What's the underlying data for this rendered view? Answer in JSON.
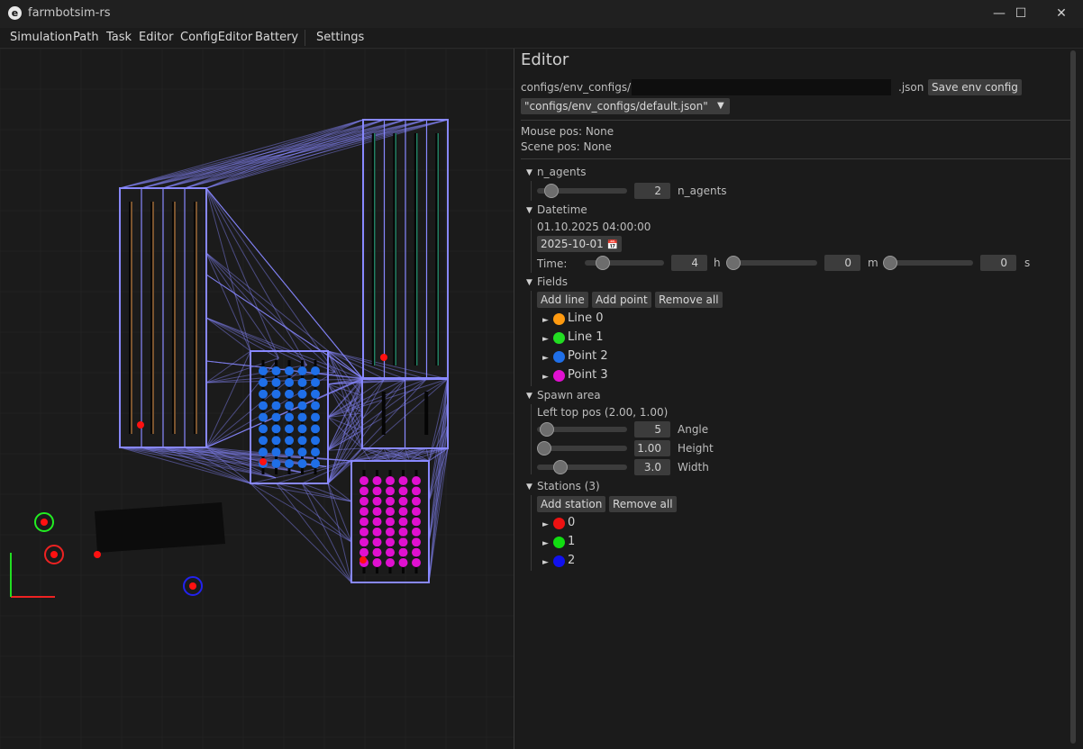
{
  "window": {
    "title": "farmbotsim-rs",
    "icon": "e",
    "controls": [
      "—",
      "☐",
      "✕"
    ]
  },
  "menu": [
    "Simulation",
    "Path",
    "Task",
    "Editor",
    "ConfigEditor",
    "Battery",
    "Settings"
  ],
  "editor": {
    "heading": "Editor",
    "config_prefix": "configs/env_configs/",
    "config_name_value": "",
    "config_suffix": ".json",
    "save_button": "Save env config",
    "dropdown_value": "\"configs/env_configs/default.json\"",
    "dropdown_arrow": "▼",
    "mouse_pos": "Mouse pos: None",
    "scene_pos": "Scene pos: None",
    "n_agents": {
      "header": "n_agents",
      "value": "2",
      "label": "n_agents",
      "slider": 0.1
    },
    "datetime": {
      "header": "Datetime",
      "text": "01.10.2025 04:00:00",
      "date_button": "2025-10-01",
      "date_icon": "📅",
      "time_label": "Time:",
      "h_value": "4",
      "h_label": "h",
      "h_slider": 0.17,
      "m_value": "0",
      "m_label": "m",
      "m_slider": 0.0,
      "s_value": "0",
      "s_label": "s",
      "s_slider": 0.0
    },
    "fields": {
      "header": "Fields",
      "add_line": "Add line",
      "add_point": "Add point",
      "remove_all": "Remove all",
      "items": [
        {
          "label": "Line 0",
          "color": "#ff9a10"
        },
        {
          "label": "Line 1",
          "color": "#22dd22"
        },
        {
          "label": "Point 2",
          "color": "#1f6fe8"
        },
        {
          "label": "Point 3",
          "color": "#e010d0"
        }
      ]
    },
    "spawn_area": {
      "header": "Spawn area",
      "left_top": "Left top pos (2.00, 1.00)",
      "angle_value": "5",
      "angle_label": "Angle",
      "angle_slider": 0.03,
      "height_value": "1.00",
      "height_label": "Height",
      "height_slider": 0.0,
      "width_value": "3.0",
      "width_label": "Width",
      "width_slider": 0.22
    },
    "stations": {
      "header": "Stations (3)",
      "add_station": "Add station",
      "remove_all": "Remove all",
      "items": [
        {
          "label": "0",
          "color": "#ee1111"
        },
        {
          "label": "1",
          "color": "#11dd11"
        },
        {
          "label": "2",
          "color": "#1111ee"
        }
      ]
    },
    "expand_arrow": "▼",
    "collapsed_arrow": "►"
  },
  "colors": {
    "field_outline": "#8888ff",
    "row_dark": "#050505",
    "line0_row": "#c98a4a",
    "line1_row": "#2aa07a",
    "point2": "#1f6fe8",
    "point3": "#e010d0",
    "station0": "#ee2222",
    "station1": "#22ee22",
    "station2": "#2222ee"
  }
}
